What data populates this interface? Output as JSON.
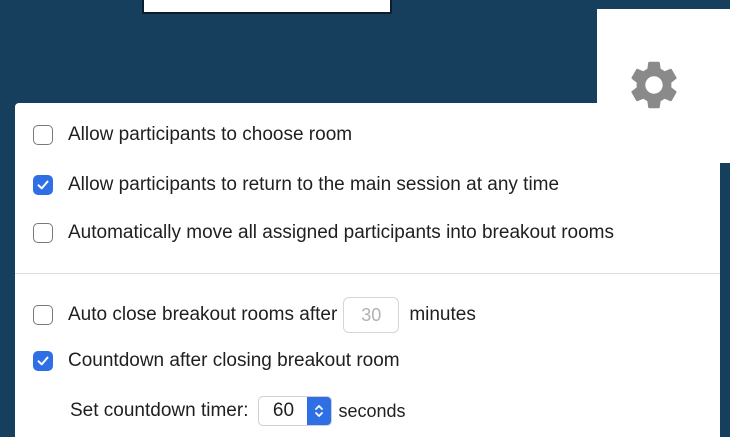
{
  "options": {
    "choose_room": {
      "label": "Allow participants to choose room",
      "checked": false
    },
    "return_main": {
      "label": "Allow participants to return to the main session at any time",
      "checked": true
    },
    "auto_move": {
      "label": "Automatically move all assigned participants into breakout rooms",
      "checked": false
    },
    "auto_close": {
      "label_before": "Auto close breakout rooms after",
      "minutes_value": "30",
      "label_after": "minutes",
      "checked": false
    },
    "countdown": {
      "label": "Countdown after closing breakout room",
      "checked": true
    },
    "countdown_timer": {
      "label": "Set countdown timer:",
      "value": "60",
      "unit": "seconds"
    }
  },
  "icons": {
    "settings": "gear-icon",
    "checkmark": "checkmark-icon",
    "stepper": "stepper-arrows-icon"
  },
  "colors": {
    "background": "#163f5e",
    "accent": "#2e6fe6",
    "gear": "#8a8a8a"
  }
}
